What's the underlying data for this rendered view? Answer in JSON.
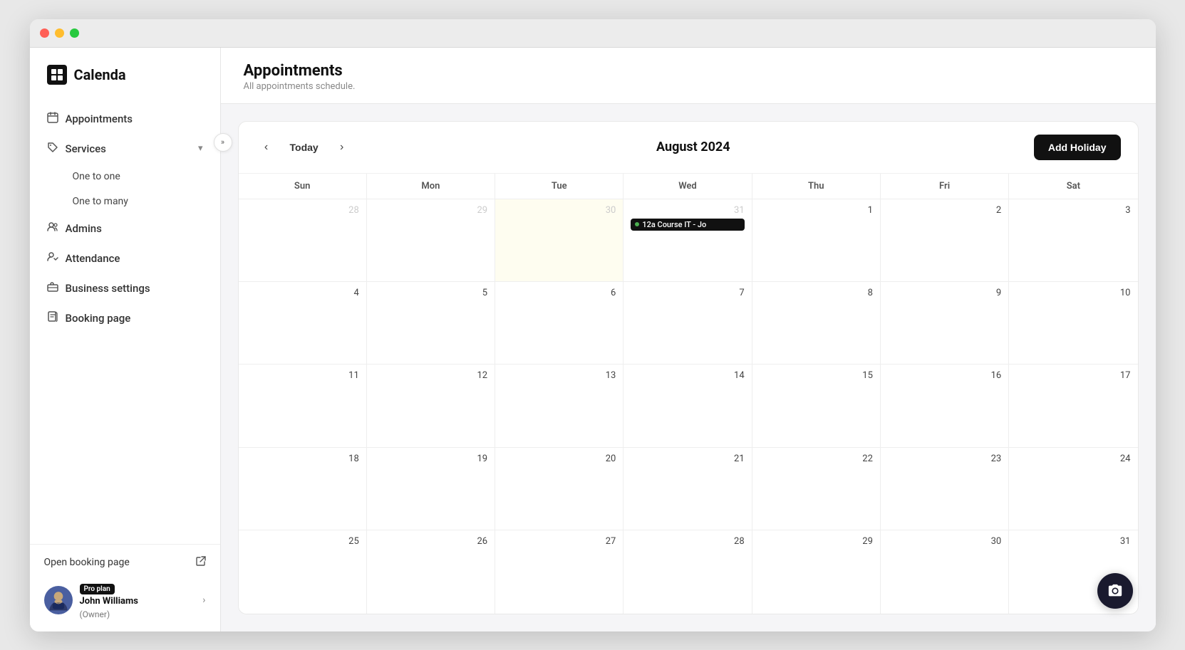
{
  "window": {
    "title": "Calenda"
  },
  "logo": {
    "icon": "+",
    "text": "Calenda"
  },
  "nav": {
    "items": [
      {
        "id": "appointments",
        "label": "Appointments",
        "icon": "calendar"
      },
      {
        "id": "services",
        "label": "Services",
        "icon": "tag",
        "hasChevron": true
      },
      {
        "id": "admins",
        "label": "Admins",
        "icon": "people"
      },
      {
        "id": "attendance",
        "label": "Attendance",
        "icon": "people-check"
      },
      {
        "id": "business-settings",
        "label": "Business settings",
        "icon": "briefcase"
      },
      {
        "id": "booking-page",
        "label": "Booking page",
        "icon": "document"
      }
    ],
    "services_sub": [
      {
        "id": "one-to-one",
        "label": "One to one"
      },
      {
        "id": "one-to-many",
        "label": "One to many"
      }
    ]
  },
  "sidebar_bottom": {
    "open_booking_label": "Open booking page"
  },
  "user": {
    "badge": "Pro plan",
    "name": "John Williams",
    "role": "(Owner)"
  },
  "page": {
    "title": "Appointments",
    "subtitle": "All appointments schedule."
  },
  "calendar": {
    "month_title": "August 2024",
    "today_label": "Today",
    "add_holiday_label": "Add Holiday",
    "weekdays": [
      "Sun",
      "Mon",
      "Tue",
      "Wed",
      "Thu",
      "Fri",
      "Sat"
    ],
    "weeks": [
      [
        {
          "num": "28",
          "other": true,
          "today": false,
          "events": []
        },
        {
          "num": "29",
          "other": true,
          "today": false,
          "events": []
        },
        {
          "num": "30",
          "other": true,
          "today": true,
          "events": []
        },
        {
          "num": "31",
          "other": true,
          "today": false,
          "events": [
            {
              "label": "12a Course IT - Jo"
            }
          ]
        },
        {
          "num": "1",
          "other": false,
          "today": false,
          "events": []
        },
        {
          "num": "2",
          "other": false,
          "today": false,
          "events": []
        },
        {
          "num": "3",
          "other": false,
          "today": false,
          "events": []
        }
      ],
      [
        {
          "num": "4",
          "other": false,
          "today": false,
          "events": []
        },
        {
          "num": "5",
          "other": false,
          "today": false,
          "events": []
        },
        {
          "num": "6",
          "other": false,
          "today": false,
          "events": []
        },
        {
          "num": "7",
          "other": false,
          "today": false,
          "events": []
        },
        {
          "num": "8",
          "other": false,
          "today": false,
          "events": []
        },
        {
          "num": "9",
          "other": false,
          "today": false,
          "events": []
        },
        {
          "num": "10",
          "other": false,
          "today": false,
          "events": []
        }
      ],
      [
        {
          "num": "11",
          "other": false,
          "today": false,
          "events": []
        },
        {
          "num": "12",
          "other": false,
          "today": false,
          "events": []
        },
        {
          "num": "13",
          "other": false,
          "today": false,
          "events": []
        },
        {
          "num": "14",
          "other": false,
          "today": false,
          "events": []
        },
        {
          "num": "15",
          "other": false,
          "today": false,
          "events": []
        },
        {
          "num": "16",
          "other": false,
          "today": false,
          "events": []
        },
        {
          "num": "17",
          "other": false,
          "today": false,
          "events": []
        }
      ],
      [
        {
          "num": "18",
          "other": false,
          "today": false,
          "events": []
        },
        {
          "num": "19",
          "other": false,
          "today": false,
          "events": []
        },
        {
          "num": "20",
          "other": false,
          "today": false,
          "events": []
        },
        {
          "num": "21",
          "other": false,
          "today": false,
          "events": []
        },
        {
          "num": "22",
          "other": false,
          "today": false,
          "events": []
        },
        {
          "num": "23",
          "other": false,
          "today": false,
          "events": []
        },
        {
          "num": "24",
          "other": false,
          "today": false,
          "events": []
        }
      ],
      [
        {
          "num": "25",
          "other": false,
          "today": false,
          "events": []
        },
        {
          "num": "26",
          "other": false,
          "today": false,
          "events": []
        },
        {
          "num": "27",
          "other": false,
          "today": false,
          "events": []
        },
        {
          "num": "28",
          "other": false,
          "today": false,
          "events": []
        },
        {
          "num": "29",
          "other": false,
          "today": false,
          "events": []
        },
        {
          "num": "30",
          "other": false,
          "today": false,
          "events": []
        },
        {
          "num": "31",
          "other": false,
          "today": false,
          "events": []
        }
      ]
    ]
  }
}
